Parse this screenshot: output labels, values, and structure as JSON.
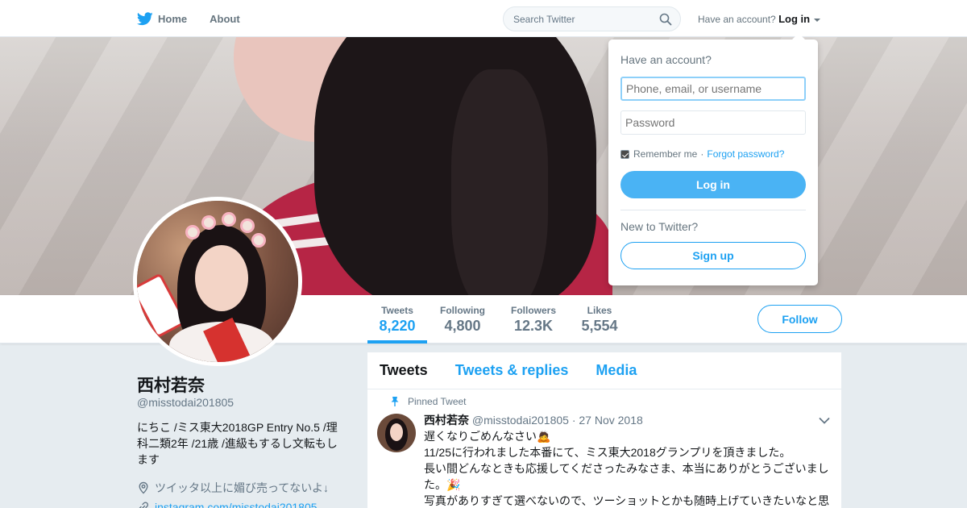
{
  "nav": {
    "home_label": "Home",
    "about_label": "About",
    "search_placeholder": "Search Twitter",
    "account_prompt": "Have an account?",
    "login_label": "Log in"
  },
  "colors": {
    "brand_blue": "#1da1f2",
    "login_button": "#4ab3f4"
  },
  "icons": {
    "logo": "twitter-bird-icon",
    "search": "search-icon",
    "location": "location-pin-icon",
    "link": "link-icon",
    "pin": "pin-icon",
    "menu": "chevron-down-icon"
  },
  "login_panel": {
    "title": "Have an account?",
    "username_placeholder": "Phone, email, or username",
    "password_placeholder": "Password",
    "remember_label": "Remember me",
    "separator": "·",
    "forgot_label": "Forgot password?",
    "remember_checked": true,
    "login_button": "Log in",
    "new_prompt": "New to Twitter?",
    "signup_button": "Sign up"
  },
  "stats": [
    {
      "label": "Tweets",
      "value": "8,220",
      "active": true
    },
    {
      "label": "Following",
      "value": "4,800",
      "active": false
    },
    {
      "label": "Followers",
      "value": "12.3K",
      "active": false
    },
    {
      "label": "Likes",
      "value": "5,554",
      "active": false
    }
  ],
  "follow_button": "Follow",
  "profile": {
    "name": "西村若奈",
    "handle": "@misstodai201805",
    "bio": "にちこ /ミス東大2018GP Entry No.5 /理科二類2年 /21歳 /進級もするし文転もします",
    "location": "ツイッタ以上に媚び売ってないよ↓",
    "link": "instagram.com/misstodai201805"
  },
  "timeline": {
    "tabs": [
      "Tweets",
      "Tweets & replies",
      "Media"
    ],
    "active_tab": 0
  },
  "tweet": {
    "pinned_label": "Pinned Tweet",
    "author_name": "西村若奈",
    "author_handle": "@misstodai201805",
    "date": "· 27 Nov 2018",
    "lines": [
      "遅くなりごめんなさい🙇",
      "11/25に行われました本番にて、ミス東大2018グランプリを頂きました。",
      "長い間どんなときも応援してくださったみなさま、本当にありがとうございました。🎉",
      "写真がありすぎて選べないので、ツーショットとかも随時上げていきたいなと思"
    ]
  }
}
